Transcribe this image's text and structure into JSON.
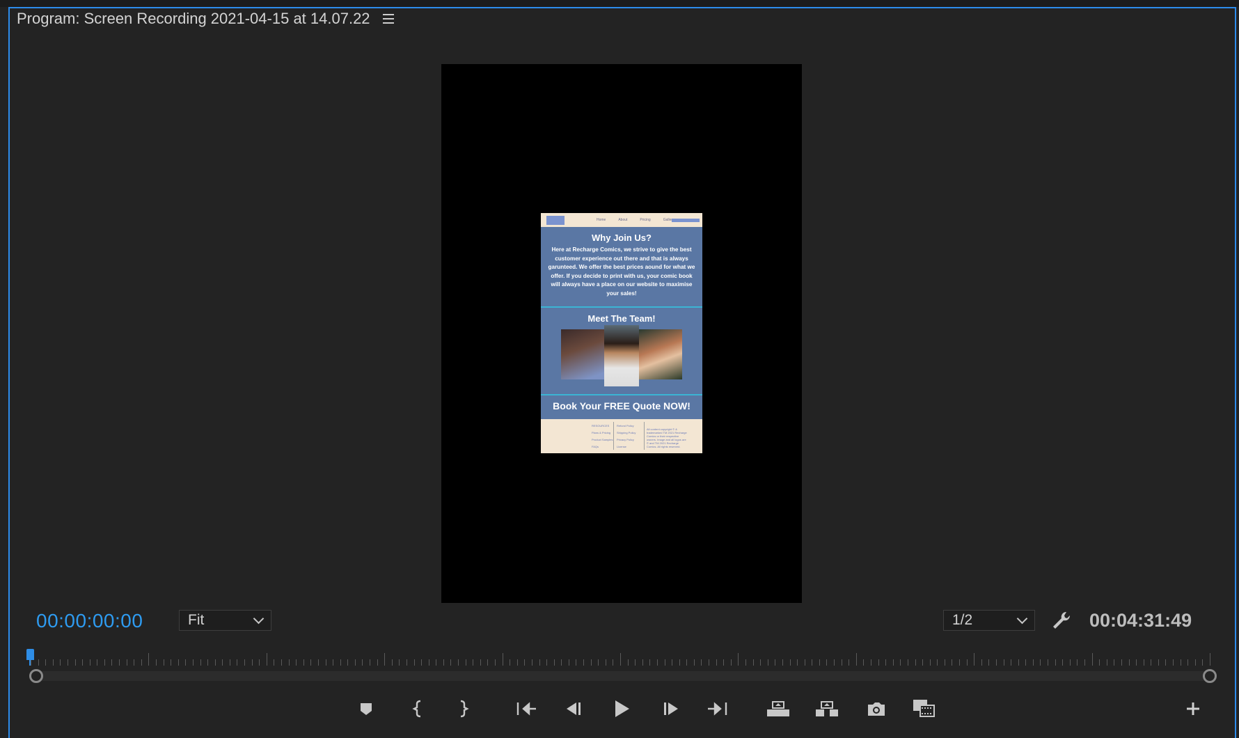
{
  "panel": {
    "title": "Program: Screen Recording 2021-04-15 at 14.07.22",
    "menu_icon": "hamburger-menu-icon"
  },
  "preview": {
    "nav_links": [
      "Home",
      "About",
      "Pricing",
      "Gallery"
    ],
    "heading_1": "Why Join Us?",
    "body_text": "Here at Recharge Comics, we strive to give the best customer experience out there and that is always garunteed. We offer the best prices aound for what we offer. If you decide to print with us, your comic book will always have a place on our website to maximise your sales!",
    "heading_2": "Meet The Team!",
    "cta": "Book Your FREE Quote NOW!",
    "footer_col1": [
      "RESOURCES",
      "Plans & Pricing",
      "Product Samples",
      "FAQs"
    ],
    "footer_col2": [
      "Refund Policy",
      "Shipping Policy",
      "Privacy Policy",
      "License"
    ],
    "footer_col3": "All content copyright © & trademarked TM 2021 Recharge Comics or their respective owners. Image and all logos are © and TM 2021 Recharge Comics. All rights reserved."
  },
  "controls": {
    "timecode_current": "00:00:00:00",
    "zoom_value": "Fit",
    "resolution_value": "1/2",
    "timecode_duration": "00:04:31:49",
    "settings_icon": "wrench-icon"
  },
  "transport": {
    "buttons": [
      "add-marker",
      "mark-in",
      "mark-out",
      "go-to-in",
      "step-back",
      "play",
      "step-forward",
      "go-to-out",
      "lift",
      "extract",
      "export-frame",
      "comparison-view",
      "button-editor"
    ]
  },
  "colors": {
    "accent": "#2e9bf0",
    "panel_bg": "#232323",
    "border": "#2d8ceb"
  }
}
